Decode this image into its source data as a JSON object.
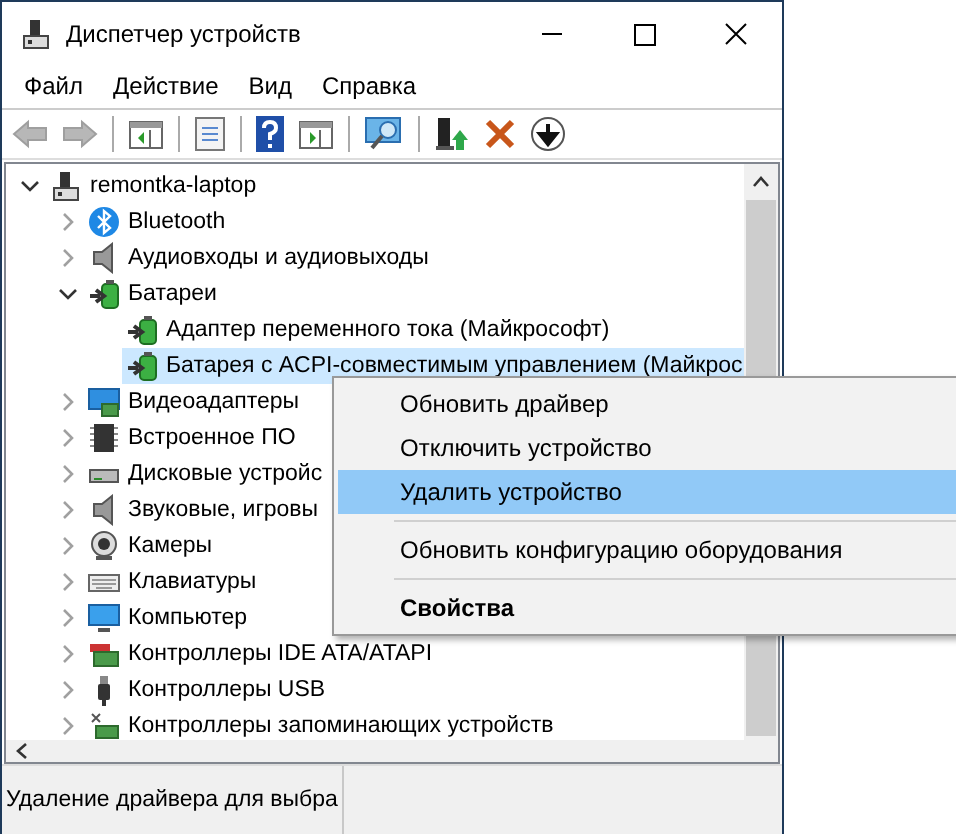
{
  "window": {
    "title": "Диспетчер устройств"
  },
  "menu": [
    {
      "label": "Файл"
    },
    {
      "label": "Действие"
    },
    {
      "label": "Вид"
    },
    {
      "label": "Справка"
    }
  ],
  "toolbar": {
    "groups": [
      [
        {
          "kind": "back",
          "disabled": true
        },
        {
          "kind": "forward",
          "disabled": true
        }
      ],
      [
        {
          "kind": "console-tree",
          "disabled": false
        }
      ],
      [
        {
          "kind": "properties",
          "disabled": false
        }
      ],
      [
        {
          "kind": "help",
          "disabled": false
        },
        {
          "kind": "action-pane",
          "disabled": false
        }
      ],
      [
        {
          "kind": "scan",
          "disabled": false
        }
      ],
      [
        {
          "kind": "update-driver",
          "disabled": false
        },
        {
          "kind": "uninstall",
          "disabled": false
        },
        {
          "kind": "download",
          "disabled": false
        }
      ]
    ]
  },
  "tree": [
    {
      "label": "remontka-laptop",
      "kind": "computer",
      "expanded": true,
      "selected": false,
      "children": [
        {
          "label": "Bluetooth",
          "kind": "bluetooth",
          "expanded": false,
          "selected": false
        },
        {
          "label": "Аудиовходы и аудиовыходы",
          "kind": "speaker",
          "expanded": false,
          "selected": false
        },
        {
          "label": "Батареи",
          "kind": "battery",
          "expanded": true,
          "selected": false,
          "children": [
            {
              "label": "Адаптер переменного тока (Майкрософт)",
              "kind": "battery",
              "selected": false
            },
            {
              "label": "Батарея с ACPI-совместимым управлением (Майкрос",
              "kind": "battery",
              "selected": true
            }
          ]
        },
        {
          "label": "Видеоадаптеры",
          "kind": "display",
          "expanded": false,
          "selected": false
        },
        {
          "label": "Встроенное ПО",
          "kind": "chip",
          "expanded": false,
          "selected": false
        },
        {
          "label": "Дисковые устройс",
          "kind": "disk",
          "expanded": false,
          "selected": false
        },
        {
          "label": "Звуковые, игровы",
          "kind": "speaker",
          "expanded": false,
          "selected": false
        },
        {
          "label": "Камеры",
          "kind": "camera",
          "expanded": false,
          "selected": false
        },
        {
          "label": "Клавиатуры",
          "kind": "keyboard",
          "expanded": false,
          "selected": false
        },
        {
          "label": "Компьютер",
          "kind": "monitor",
          "expanded": false,
          "selected": false
        },
        {
          "label": "Контроллеры IDE ATA/ATAPI",
          "kind": "ide",
          "expanded": false,
          "selected": false
        },
        {
          "label": "Контроллеры USB",
          "kind": "usb",
          "expanded": false,
          "selected": false
        },
        {
          "label": "Контроллеры запоминающих устройств",
          "kind": "storage",
          "expanded": false,
          "selected": false
        }
      ]
    }
  ],
  "context_menu": [
    {
      "kind": "item",
      "label": "Обновить драйвер",
      "selected": false
    },
    {
      "kind": "item",
      "label": "Отключить устройство",
      "selected": false
    },
    {
      "kind": "item",
      "label": "Удалить устройство",
      "selected": true
    },
    {
      "kind": "separator"
    },
    {
      "kind": "item",
      "label": "Обновить конфигурацию оборудования",
      "selected": false
    },
    {
      "kind": "separator"
    },
    {
      "kind": "default",
      "label": "Свойства",
      "selected": false
    }
  ],
  "status_bar": [
    {
      "text": "Удаление драйвера для выбра"
    }
  ]
}
